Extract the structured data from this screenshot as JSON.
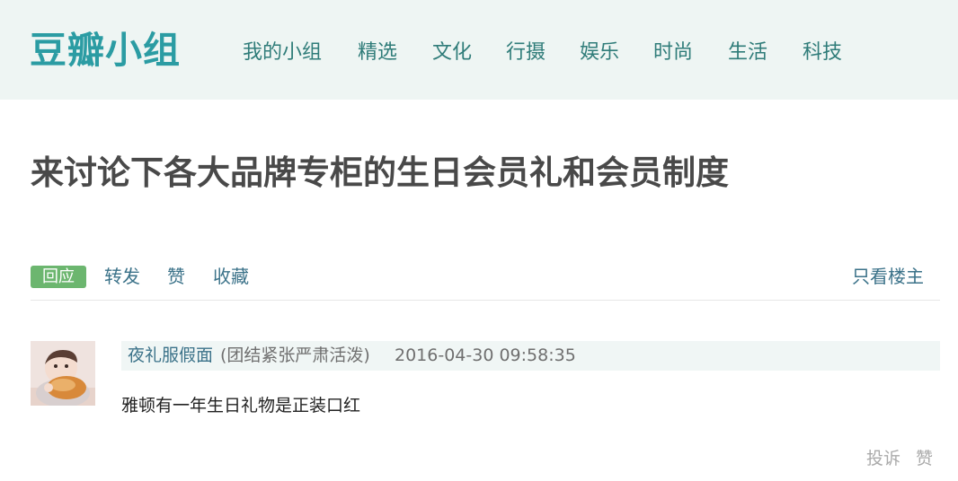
{
  "header": {
    "logo": "豆瓣小组",
    "nav": [
      "我的小组",
      "精选",
      "文化",
      "行摄",
      "娱乐",
      "时尚",
      "生活",
      "科技"
    ]
  },
  "topic": {
    "title": "来讨论下各大品牌专柜的生日会员礼和会员制度"
  },
  "actions": {
    "reply": "回应",
    "forward": "转发",
    "like": "赞",
    "collect": "收藏",
    "only_op": "只看楼主"
  },
  "post": {
    "author": "夜礼服假面",
    "signature": "(团结紧张严肃活泼)",
    "time": "2016-04-30 09:58:35",
    "content": "雅顿有一年生日礼物是正装口红",
    "report": "投诉",
    "like": "赞"
  }
}
